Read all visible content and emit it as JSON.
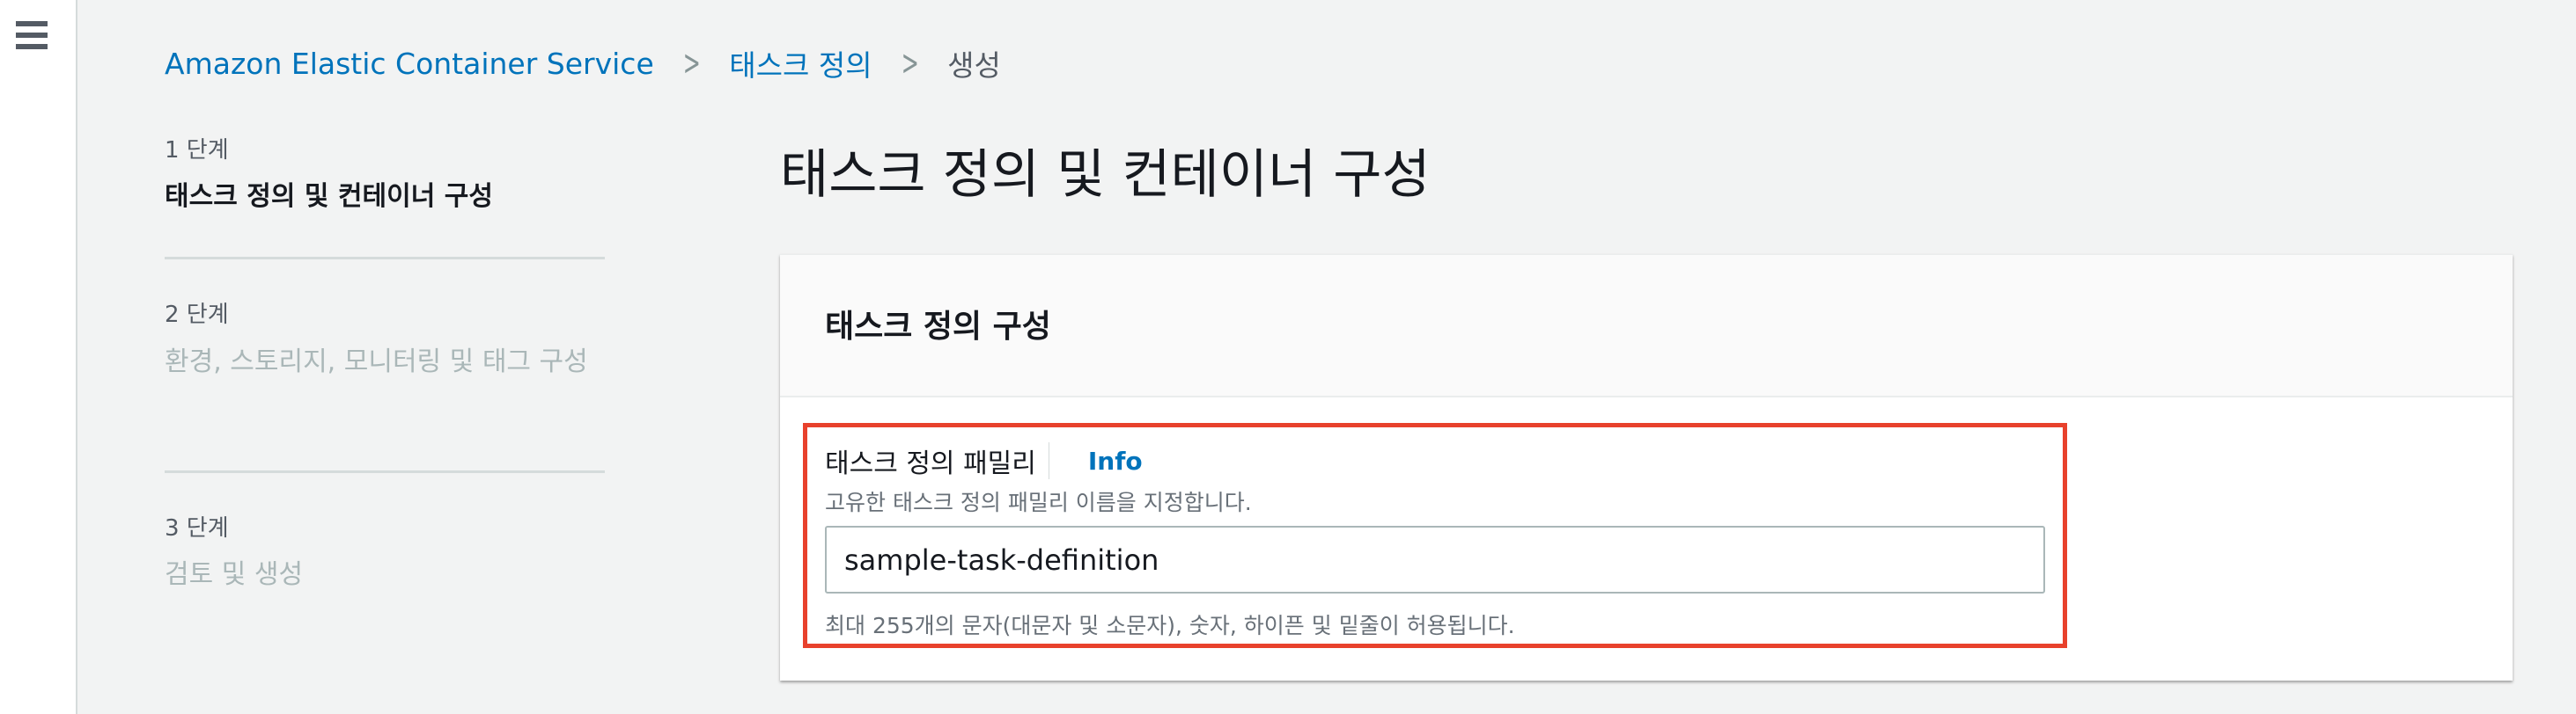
{
  "nav": {
    "menu_icon": "hamburger-icon"
  },
  "breadcrumb": {
    "items": [
      "Amazon Elastic Container Service",
      "태스크 정의",
      "생성"
    ],
    "separator_icon": "chevron-right-icon"
  },
  "wizard": {
    "steps": [
      {
        "number": "1 단계",
        "title": "태스크 정의 및 컨테이너 구성",
        "active": true
      },
      {
        "number": "2 단계",
        "title": "환경, 스토리지, 모니터링 및 태그 구성",
        "active": false
      },
      {
        "number": "3 단계",
        "title": "검토 및 생성",
        "active": false
      }
    ]
  },
  "main": {
    "title": "태스크 정의 및 컨테이너 구성",
    "card": {
      "title": "태스크 정의 구성",
      "field": {
        "label": "태스크 정의 패밀리",
        "info_label": "Info",
        "description": "고유한 태스크 정의 패밀리 이름을 지정합니다.",
        "value": "sample-task-definition",
        "constraint": "최대 255개의 문자(대문자 및 소문자), 숫자, 하이픈 및 밑줄이 허용됩니다."
      }
    }
  },
  "colors": {
    "link": "#0073bb",
    "highlight": "#e8412c",
    "background": "#f2f3f3"
  }
}
